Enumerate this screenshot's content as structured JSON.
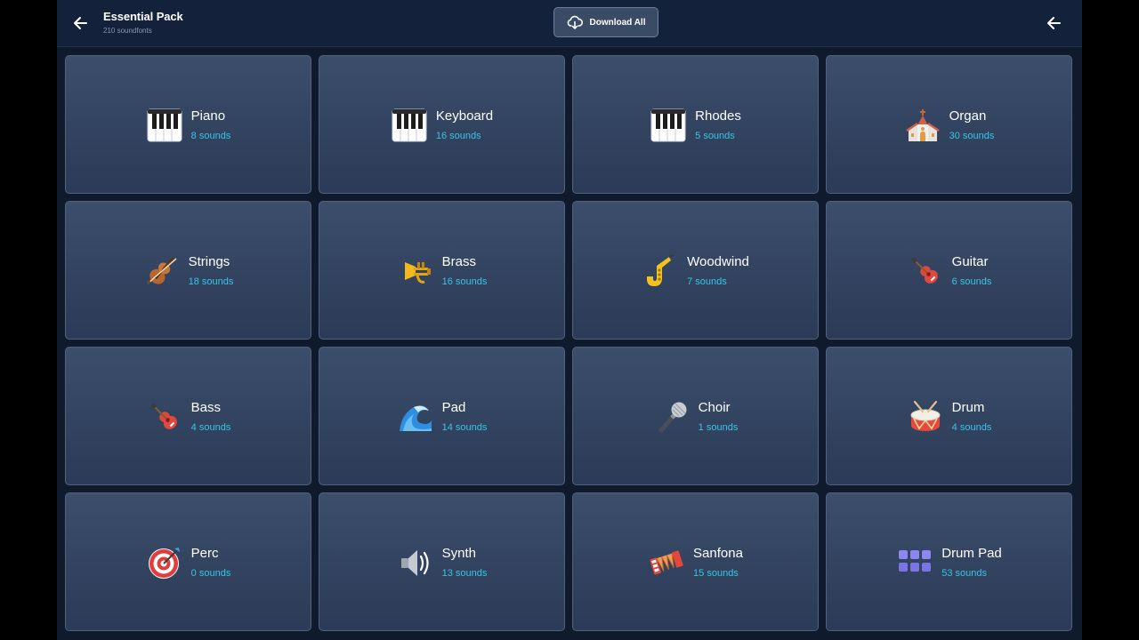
{
  "header": {
    "title": "Essential Pack",
    "subtitle": "210 soundfonts",
    "download_label": "Download All",
    "back_icon": "arrow-left-icon",
    "download_icon": "cloud-download-icon"
  },
  "colors": {
    "background": "#0f1a2c",
    "header": "#14213a",
    "card": "#354662",
    "card_border": "#52627c",
    "accent": "#3bc3e4",
    "button": "#3a4b66"
  },
  "instruments": [
    {
      "name": "Piano",
      "count": "8 sounds",
      "icon": "piano-keys-icon"
    },
    {
      "name": "Keyboard",
      "count": "16 sounds",
      "icon": "piano-keys-icon"
    },
    {
      "name": "Rhodes",
      "count": "5 sounds",
      "icon": "piano-keys-icon"
    },
    {
      "name": "Organ",
      "count": "30 sounds",
      "icon": "church-icon"
    },
    {
      "name": "Strings",
      "count": "18 sounds",
      "icon": "violin-icon"
    },
    {
      "name": "Brass",
      "count": "16 sounds",
      "icon": "trumpet-icon"
    },
    {
      "name": "Woodwind",
      "count": "7 sounds",
      "icon": "saxophone-icon"
    },
    {
      "name": "Guitar",
      "count": "6 sounds",
      "icon": "guitar-icon"
    },
    {
      "name": "Bass",
      "count": "4 sounds",
      "icon": "guitar-icon"
    },
    {
      "name": "Pad",
      "count": "14 sounds",
      "icon": "wave-icon"
    },
    {
      "name": "Choir",
      "count": "1 sounds",
      "icon": "microphone-icon"
    },
    {
      "name": "Drum",
      "count": "4 sounds",
      "icon": "drum-icon"
    },
    {
      "name": "Perc",
      "count": "0 sounds",
      "icon": "target-icon"
    },
    {
      "name": "Synth",
      "count": "13 sounds",
      "icon": "speaker-icon"
    },
    {
      "name": "Sanfona",
      "count": "15 sounds",
      "icon": "accordion-icon"
    },
    {
      "name": "Drum Pad",
      "count": "53 sounds",
      "icon": "drum-pad-icon"
    }
  ]
}
